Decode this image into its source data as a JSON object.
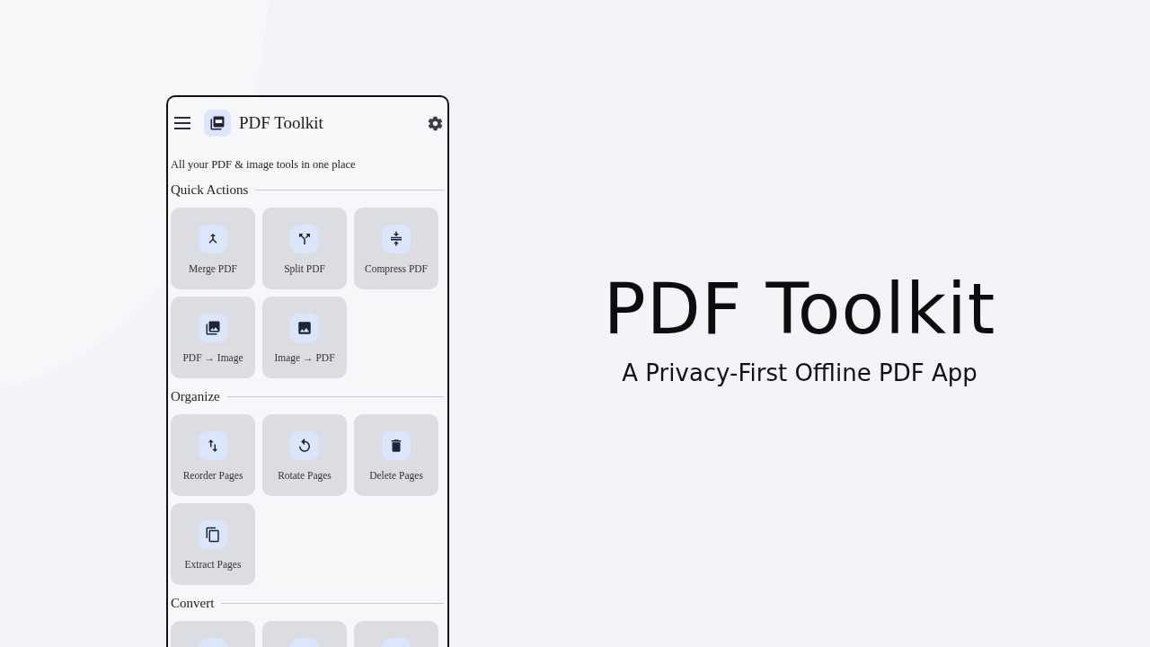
{
  "app": {
    "title": "PDF Toolkit",
    "tagline": "All your PDF & image tools in one place"
  },
  "sections": [
    {
      "title": "Quick Actions",
      "tiles": [
        {
          "kind": "merge",
          "label": "Merge PDF"
        },
        {
          "kind": "split",
          "label": "Split PDF"
        },
        {
          "kind": "compress",
          "label": "Compress PDF"
        },
        {
          "kind": "gallery",
          "label": "PDF → Image"
        },
        {
          "kind": "image",
          "label": "Image → PDF"
        }
      ]
    },
    {
      "title": "Organize",
      "tiles": [
        {
          "kind": "reorder",
          "label": "Reorder Pages"
        },
        {
          "kind": "rotate",
          "label": "Rotate Pages"
        },
        {
          "kind": "delete",
          "label": "Delete Pages"
        },
        {
          "kind": "copy",
          "label": "Extract Pages"
        }
      ]
    },
    {
      "title": "Convert",
      "tiles": [
        {
          "kind": "cut"
        },
        {
          "kind": "cut"
        },
        {
          "kind": "cut"
        }
      ]
    }
  ],
  "promo": {
    "title": "PDF Toolkit",
    "subtitle": "A Privacy-First Offline PDF App"
  }
}
